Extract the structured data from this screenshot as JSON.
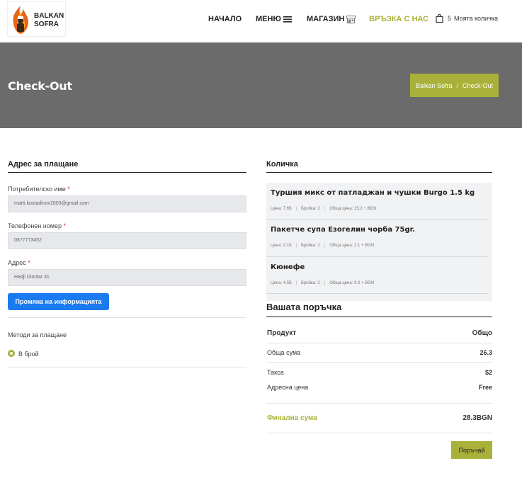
{
  "header": {
    "logo_text": [
      "BALKAN",
      "SOFRA"
    ],
    "nav": [
      {
        "label": "НАЧАЛО"
      },
      {
        "label": "МЕНЮ"
      },
      {
        "label": "МАГАЗИН"
      },
      {
        "label": "ВРЪЗКА С НАС"
      }
    ],
    "cart_count": "5",
    "cart_label": "Моята количка"
  },
  "banner": {
    "title": "Check-Out",
    "breadcrumb": [
      "Balkan Sofra",
      "Check-Out"
    ],
    "breadcrumb_sep": "/"
  },
  "billing": {
    "title": "Адрес за плащане",
    "fields": [
      {
        "label": "Потребителско име",
        "value": "marti.kostadinov2003@gmail.com"
      },
      {
        "label": "Телефонен номер",
        "value": "0877773452"
      },
      {
        "label": "Адрес",
        "value": "Hadji Dimitar 31"
      }
    ],
    "required_mark": "*",
    "update_button": "Промяна на информацията",
    "payment_title": "Методи за плащане",
    "payment_option": "В брой"
  },
  "cart": {
    "title": "Количка",
    "items": [
      {
        "name": "Туршия микс от патладжан и чушки Burgo 1.5 kg",
        "price": "Цена: 7.6$",
        "qty": "Бройка: 2",
        "total": "Обща цена: 15.2 + BGN"
      },
      {
        "name": "Пакетче супа Езогелин чорба 75gr.",
        "price": "Цена: 2.1$",
        "qty": "Бройка: 1",
        "total": "Обща цена: 2.1 + BGN"
      },
      {
        "name": "Кюнефе",
        "price": "Цена: 4.5$",
        "qty": "Бройка: 2",
        "total": "Обща цена: 9.0 + BGN"
      }
    ]
  },
  "order": {
    "title": "Вашата поръчка",
    "col_product": "Продукт",
    "col_total": "Общо",
    "subtotal_label": "Обща сума",
    "subtotal_value": "26.3",
    "tax_label": "Такса",
    "tax_value": "$2",
    "shipping_label": "Адресна цена",
    "shipping_value": "Free",
    "final_label": "Финална сума",
    "final_value": "28.3BGN",
    "order_button": "Поръчай"
  },
  "colors": {
    "accent": "#a9b13a",
    "banner": "#6b6b6b",
    "button_blue": "#1a7af0"
  }
}
